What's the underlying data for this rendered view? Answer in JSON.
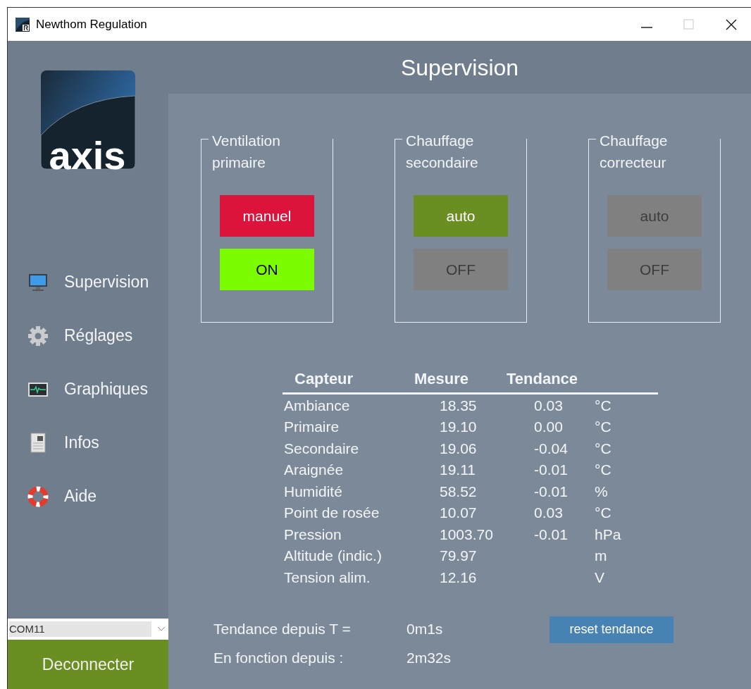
{
  "window": {
    "title": "Newthom Regulation"
  },
  "header": {
    "title": "Supervision"
  },
  "sidebar": {
    "items": [
      {
        "label": "Supervision",
        "kind": "monitor"
      },
      {
        "label": "Réglages",
        "kind": "gear"
      },
      {
        "label": "Graphiques",
        "kind": "graph"
      },
      {
        "label": "Infos",
        "kind": "document"
      },
      {
        "label": "Aide",
        "kind": "lifebuoy"
      }
    ],
    "port": {
      "value": "COM11"
    },
    "connect_button": "Deconnecter"
  },
  "logo": {
    "text": "axis"
  },
  "groups": [
    {
      "title": "Ventilation primaire",
      "mode": {
        "label": "manuel",
        "kind": "manual"
      },
      "power": {
        "label": "ON",
        "on": true
      }
    },
    {
      "title": "Chauffage secondaire",
      "mode": {
        "label": "auto",
        "kind": "auto"
      },
      "power": {
        "label": "OFF",
        "on": false
      }
    },
    {
      "title": "Chauffage correcteur",
      "mode": {
        "label": "auto",
        "kind": "inactive"
      },
      "power": {
        "label": "OFF",
        "on": false
      }
    }
  ],
  "table": {
    "columns": [
      "Capteur",
      "Mesure",
      "Tendance"
    ],
    "rows": [
      {
        "sensor": "Ambiance",
        "value": "18.35",
        "trend": "0.03",
        "unit": "°C"
      },
      {
        "sensor": "Primaire",
        "value": "19.10",
        "trend": "0.00",
        "unit": "°C"
      },
      {
        "sensor": "Secondaire",
        "value": "19.06",
        "trend": "-0.04",
        "unit": "°C"
      },
      {
        "sensor": "Araignée",
        "value": "19.11",
        "trend": "-0.01",
        "unit": "°C"
      },
      {
        "sensor": "Humidité",
        "value": "58.52",
        "trend": "-0.01",
        "unit": "%"
      },
      {
        "sensor": "Point de rosée",
        "value": "10.07",
        "trend": "0.03",
        "unit": "°C"
      },
      {
        "sensor": "Pression",
        "value": "1003.70",
        "trend": "-0.01",
        "unit": "hPa"
      },
      {
        "sensor": "Altitude (indic.)",
        "value": "79.97",
        "unit": "m"
      },
      {
        "sensor": "Tension alim.",
        "value": "12.16",
        "unit": "V"
      }
    ]
  },
  "status": [
    {
      "label": "Tendance depuis T =",
      "value": "0m1s"
    },
    {
      "label": "En fonction depuis :",
      "value": "2m32s"
    }
  ],
  "reset_button": "reset tendance"
}
